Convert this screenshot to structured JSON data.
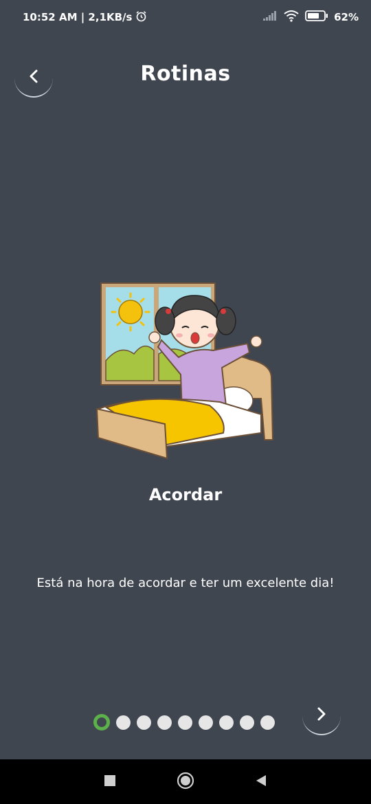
{
  "status_bar": {
    "time_speed": "10:52 AM | 2,1KB/s",
    "battery": "62%"
  },
  "header": {
    "title": "Rotinas"
  },
  "routine": {
    "name": "Acordar",
    "description": "Está na hora de acordar e ter um excelente dia!"
  },
  "pager": {
    "total": 9,
    "active_index": 0
  },
  "colors": {
    "background": "#404650",
    "active_dot": "#5db14a",
    "inactive_dot": "#e6e6e6",
    "nav_bar": "#000000"
  },
  "icons": [
    "alarm-icon",
    "signal-icon",
    "wifi-icon",
    "battery-icon",
    "back-arrow-icon",
    "next-arrow-icon",
    "square-icon",
    "circle-home-icon",
    "triangle-back-icon"
  ]
}
